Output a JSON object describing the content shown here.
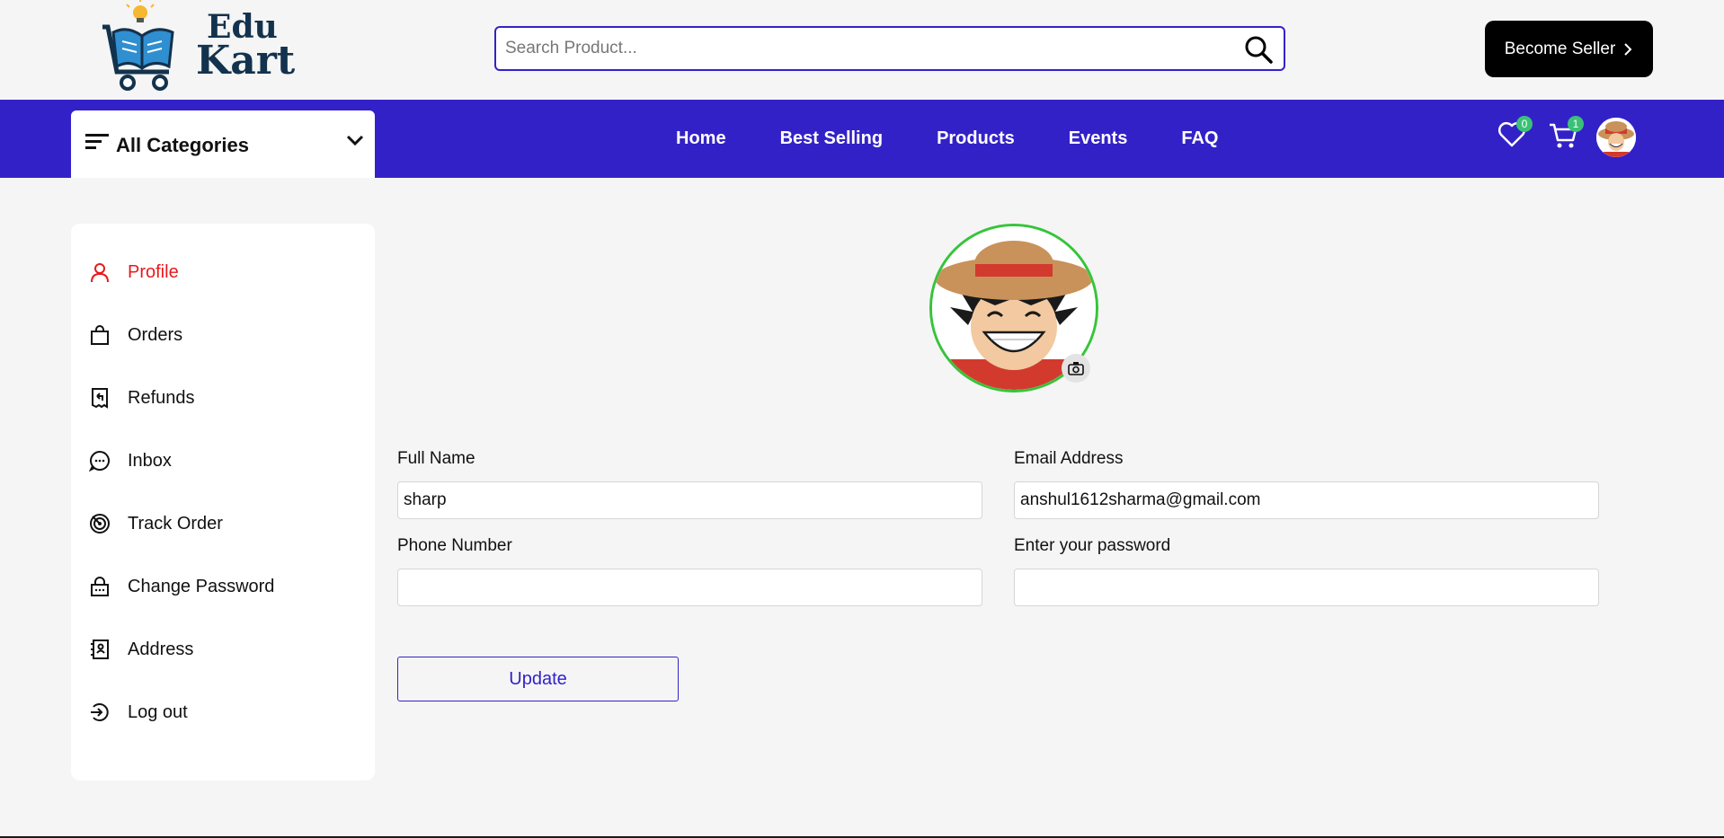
{
  "header": {
    "logo_line1": "Edu",
    "logo_line2": "Kart",
    "search_placeholder": "Search Product...",
    "seller_button": "Become Seller"
  },
  "nav": {
    "categories_label": "All Categories",
    "links": [
      "Home",
      "Best Selling",
      "Products",
      "Events",
      "FAQ"
    ],
    "wishlist_count": "0",
    "cart_count": "1"
  },
  "sidebar": {
    "items": [
      {
        "label": "Profile",
        "icon": "person-icon"
      },
      {
        "label": "Orders",
        "icon": "shopping-bag-icon"
      },
      {
        "label": "Refunds",
        "icon": "refund-receipt-icon"
      },
      {
        "label": "Inbox",
        "icon": "chat-bubble-icon"
      },
      {
        "label": "Track Order",
        "icon": "radar-icon"
      },
      {
        "label": "Change Password",
        "icon": "lock-icon"
      },
      {
        "label": "Address",
        "icon": "address-book-icon"
      },
      {
        "label": "Log out",
        "icon": "logout-icon"
      }
    ]
  },
  "profile": {
    "full_name_label": "Full Name",
    "full_name_value": "sharp",
    "email_label": "Email Address",
    "email_value": "anshul1612sharma@gmail.com",
    "phone_label": "Phone Number",
    "phone_value": "",
    "password_label": "Enter your password",
    "password_value": "",
    "update_button": "Update"
  },
  "colors": {
    "brand": "#3321c8",
    "active": "#e8191c",
    "badge": "#3bc177",
    "avatar_ring": "#36c43a"
  }
}
